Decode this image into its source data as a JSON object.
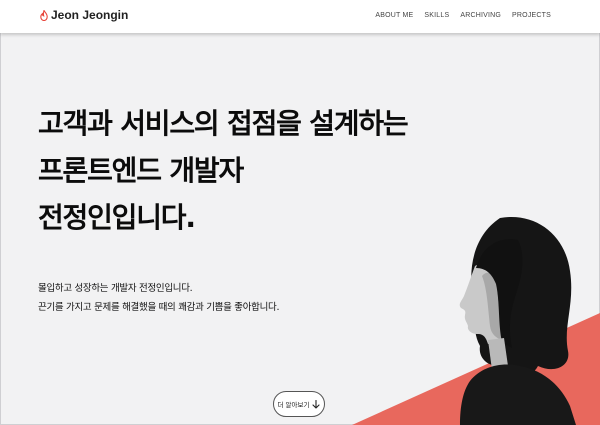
{
  "header": {
    "brand_name": "Jeon Jeongin",
    "logo_icon": "flame-icon",
    "nav": [
      {
        "label": "ABOUT ME"
      },
      {
        "label": "SKILLS"
      },
      {
        "label": "ARCHIVING"
      },
      {
        "label": "PROJECTS"
      }
    ]
  },
  "hero": {
    "headline": [
      "고객과 서비스의 접점을 설계하는",
      "프론트엔드 개발자",
      "전정인입니다."
    ],
    "description": [
      "몰입하고 성장하는 개발자 전정인입니다.",
      "끈기를 가지고 문제를 해결했을 때의 쾌감과 기쁨을 좋아합니다."
    ],
    "more_button": {
      "label": "더 알아보기",
      "icon": "arrow-down-icon"
    },
    "portrait_alt": "portrait-photo"
  },
  "colors": {
    "accent": "#e8685d",
    "background": "#f2f2f3",
    "header_bg": "#ffffff",
    "logo": "#e8463c"
  }
}
